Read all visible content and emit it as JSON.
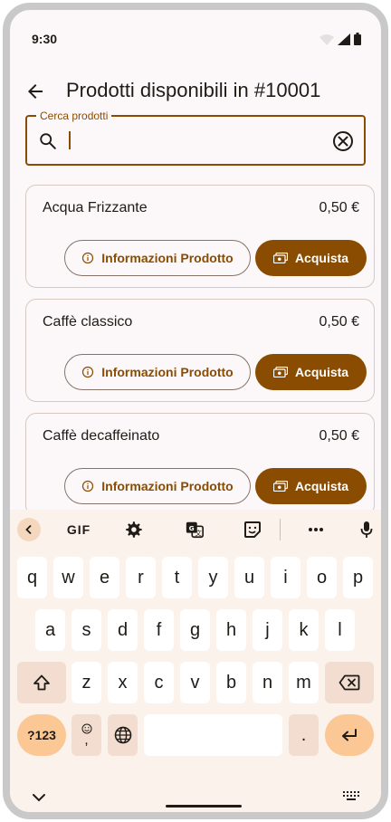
{
  "status": {
    "time": "9:30"
  },
  "appbar": {
    "title": "Prodotti disponibili in #10001"
  },
  "search": {
    "label": "Cerca prodotti",
    "value": "",
    "placeholder": ""
  },
  "products": [
    {
      "name": "Acqua Frizzante",
      "price": "0,50 €",
      "info_label": "Informazioni Prodotto",
      "buy_label": "Acquista"
    },
    {
      "name": "Caffè classico",
      "price": "0,50 €",
      "info_label": "Informazioni Prodotto",
      "buy_label": "Acquista"
    },
    {
      "name": "Caffè decaffeinato",
      "price": "0,50 €",
      "info_label": "Informazioni Prodotto",
      "buy_label": "Acquista"
    }
  ],
  "keyboard": {
    "toolbar": {
      "gif_label": "GIF"
    },
    "row1": [
      "q",
      "w",
      "e",
      "r",
      "t",
      "y",
      "u",
      "i",
      "o",
      "p"
    ],
    "row2": [
      "a",
      "s",
      "d",
      "f",
      "g",
      "h",
      "j",
      "k",
      "l"
    ],
    "row3": [
      "z",
      "x",
      "c",
      "v",
      "b",
      "n",
      "m"
    ],
    "sym_label": "?123",
    "comma_label": ",",
    "period_label": "."
  },
  "colors": {
    "primary": "#8a4c00",
    "background": "#fcf7f9",
    "keyboard": "#fbf2ec",
    "accent_key": "#fbc895"
  }
}
